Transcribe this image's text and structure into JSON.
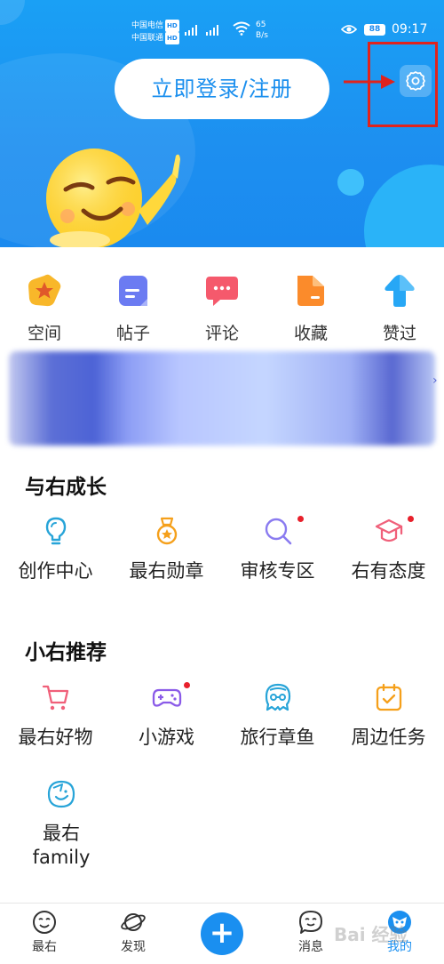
{
  "status_bar": {
    "carrier1": "中国电信",
    "carrier2": "中国联通",
    "hd_badge": "HD",
    "network1": "4G",
    "network2": "4G",
    "speed_value": "65",
    "speed_unit": "B/s",
    "battery": "88",
    "time": "09:17"
  },
  "header": {
    "login_label": "立即登录/注册"
  },
  "quick_actions": [
    {
      "label": "空间",
      "icon": "space-icon",
      "color": "#f8b72a"
    },
    {
      "label": "帖子",
      "icon": "post-icon",
      "color": "#6b7bf2"
    },
    {
      "label": "评论",
      "icon": "comment-icon",
      "color": "#f5596c"
    },
    {
      "label": "收藏",
      "icon": "favorite-icon",
      "color": "#fb8b2b"
    },
    {
      "label": "赞过",
      "icon": "like-icon",
      "color": "#27a7f5"
    }
  ],
  "sections": {
    "growth_title": "与右成长",
    "growth_items": [
      {
        "label": "创作中心",
        "icon": "lightbulb-icon"
      },
      {
        "label": "最右勋章",
        "icon": "medal-icon"
      },
      {
        "label": "审核专区",
        "icon": "search-icon"
      },
      {
        "label": "右有态度",
        "icon": "graduation-cap-icon"
      }
    ],
    "recommend_title": "小右推荐",
    "recommend_items": [
      {
        "label": "最右好物",
        "icon": "shopping-cart-icon"
      },
      {
        "label": "小游戏",
        "icon": "gamepad-icon"
      },
      {
        "label": "旅行章鱼",
        "icon": "octopus-icon"
      },
      {
        "label": "周边任务",
        "icon": "calendar-check-icon"
      }
    ],
    "family_line1": "最右",
    "family_line2": "family"
  },
  "bottom_nav": [
    {
      "label": "最右",
      "icon": "home-face-icon"
    },
    {
      "label": "发现",
      "icon": "planet-icon"
    },
    {
      "label": "",
      "icon": "plus-icon"
    },
    {
      "label": "消息",
      "icon": "message-icon"
    },
    {
      "label": "我的",
      "icon": "profile-icon"
    }
  ],
  "watermark": "Bai 经验"
}
